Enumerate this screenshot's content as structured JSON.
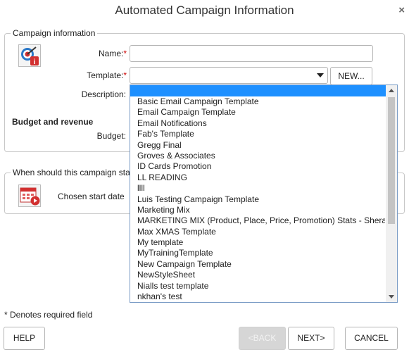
{
  "window": {
    "title": "Automated Campaign Information",
    "close_icon": "×"
  },
  "campaign_info": {
    "legend": "Campaign information",
    "name_label": "Name:",
    "name_value": "",
    "template_label": "Template:",
    "template_value": "",
    "new_button": "NEW...",
    "description_label": "Description:",
    "required_mark": "*"
  },
  "budget": {
    "heading": "Budget and revenue",
    "budget_label": "Budget:"
  },
  "schedule": {
    "legend": "When should this campaign sta",
    "start_label": "Chosen start date"
  },
  "template_dropdown": {
    "options": [
      "Basic Email Campaign Template",
      "Email Campaign Template",
      "Email Notifications",
      "Fab's Template",
      "Gregg Final",
      "Groves & Associates",
      "ID Cards Promotion",
      "LL READING",
      "llll",
      "Luis Testing Campaign Template",
      "Marketing Mix",
      "MARKETING MIX (Product, Place, Price, Promotion) Stats - Sheraz",
      "Max XMAS Template",
      "My template",
      "MyTrainingTemplate",
      "New Campaign Template",
      "NewStyleSheet",
      "Nialls test template",
      "nkhan's test"
    ]
  },
  "footer": {
    "required_note": "* Denotes required field",
    "help": "HELP",
    "back": "<BACK",
    "next": "NEXT>",
    "cancel": "CANCEL"
  },
  "colors": {
    "selection_highlight": "#1e90ff",
    "required": "#cc0000"
  }
}
